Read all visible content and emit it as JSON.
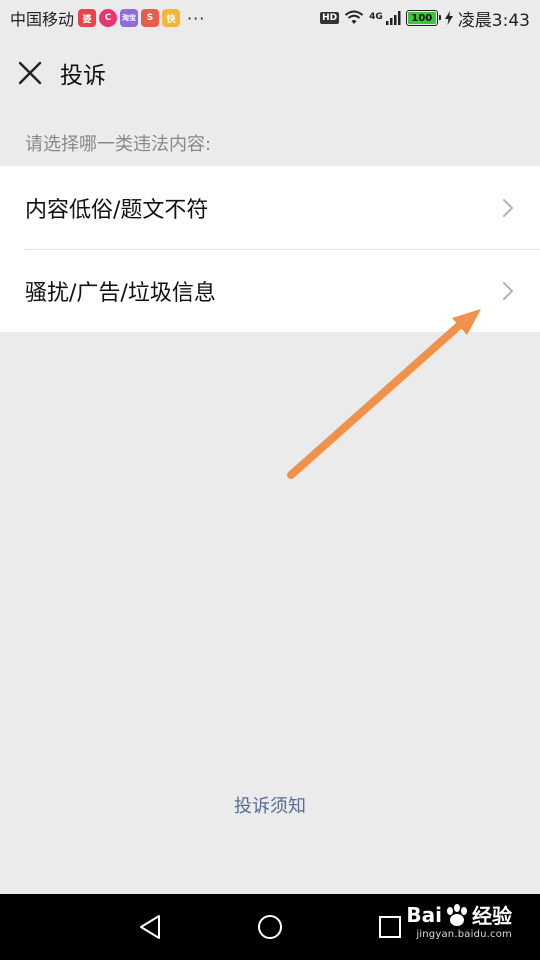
{
  "status_bar": {
    "carrier": "中国移动",
    "app_badges": [
      {
        "icon": "heart-app-icon",
        "text": "婆",
        "color": "#e8434b"
      },
      {
        "icon": "circle-app-icon",
        "text": "C",
        "color": "#e83570"
      },
      {
        "icon": "taobao-app-icon",
        "text": "淘宝",
        "color": "#8e6ce0"
      },
      {
        "icon": "s-app-icon",
        "text": "S",
        "color": "#e85c4a"
      },
      {
        "icon": "yellow-app-icon",
        "text": "快",
        "color": "#f4b63a"
      }
    ],
    "more": "···",
    "hd": "HD",
    "network": "4G",
    "battery": "100",
    "time": "凌晨3:43"
  },
  "header": {
    "title": "投诉",
    "close_icon": "close-icon"
  },
  "section_label": "请选择哪一类违法内容:",
  "options": [
    {
      "label": "内容低俗/题文不符"
    },
    {
      "label": "骚扰/广告/垃圾信息"
    }
  ],
  "footer_link": "投诉须知",
  "watermark": {
    "brand_left": "Bai",
    "brand_right": "经验",
    "url": "jingyan.baidu.com"
  },
  "colors": {
    "background": "#ebebeb",
    "link": "#576b95",
    "annotation_arrow": "#f0924a",
    "battery": "#3ec43a"
  }
}
